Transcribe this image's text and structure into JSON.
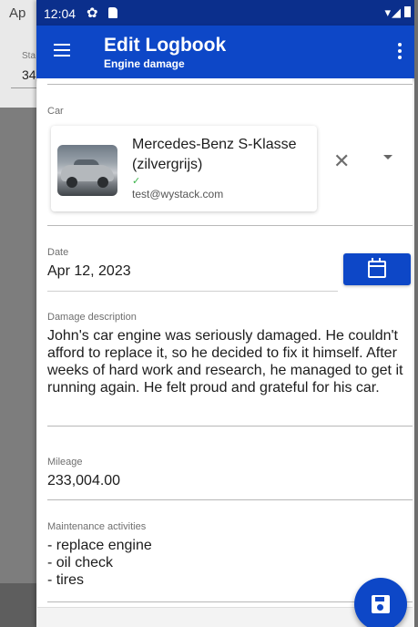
{
  "background_app": {
    "title_fragment": "Ap",
    "label_fragment": "Sta",
    "value_fragment": "34"
  },
  "statusbar": {
    "time": "12:04",
    "icons": [
      "gear-icon",
      "sd-card-icon",
      "wifi-icon",
      "signal-icon",
      "battery-icon"
    ]
  },
  "appbar": {
    "title": "Edit Logbook",
    "subtitle": "Engine damage",
    "color": "#0d47c7"
  },
  "form": {
    "car": {
      "label": "Car",
      "name": "Mercedes-Benz S-Klasse (zilvergrijs)",
      "verified_mark": "✓",
      "owner": "test@wystack.com"
    },
    "date": {
      "label": "Date",
      "value": "Apr 12, 2023"
    },
    "damage_description": {
      "label": "Damage description",
      "value": "John's car engine was seriously damaged. He couldn't afford to replace it, so he decided to fix it himself. After weeks of hard work and research, he managed to get it running again. He felt proud and grateful for his car."
    },
    "mileage": {
      "label": "Mileage",
      "value": "233,004.00"
    },
    "maintenance_activities": {
      "label": "Maintenance activities",
      "items": [
        "- replace engine",
        "- oil check",
        "- tires"
      ]
    }
  }
}
